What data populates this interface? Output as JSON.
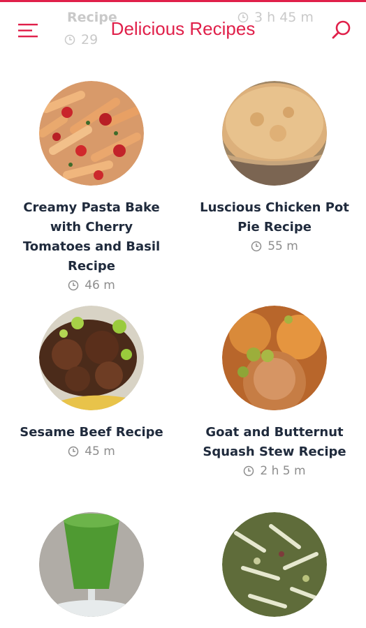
{
  "app": {
    "title": "Delicious Recipes"
  },
  "colors": {
    "accent": "#e0204a",
    "text": "#1f2a3c",
    "muted": "#8d8d8d"
  },
  "header": {
    "menu_icon": "hamburger-menu-icon",
    "search_icon": "search-icon",
    "ghost_left_title": "Recipe",
    "ghost_left_time": "29",
    "ghost_right_time": "3 h 45 m"
  },
  "recipes": [
    {
      "name": "Creamy Pasta Bake with Cherry Tomatoes and Basil Recipe",
      "time": "46 m",
      "image": "pasta"
    },
    {
      "name": "Luscious Chicken Pot Pie Recipe",
      "time": "55 m",
      "image": "pie"
    },
    {
      "name": "Sesame Beef Recipe",
      "time": "45 m",
      "image": "beef"
    },
    {
      "name": "Goat and Butternut Squash Stew Recipe",
      "time": "2 h 5 m",
      "image": "stew"
    },
    {
      "name": "",
      "time": "",
      "image": "green-drink"
    },
    {
      "name": "",
      "time": "",
      "image": "salad"
    }
  ]
}
